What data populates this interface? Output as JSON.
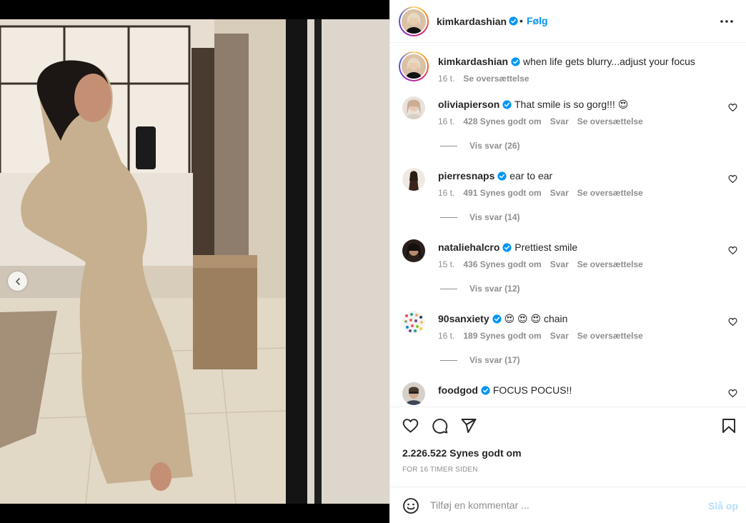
{
  "post": {
    "author": "kimkardashian",
    "follow_label": "Følg",
    "separator": "•",
    "caption": "when life gets blurry...adjust your focus",
    "caption_time": "16 t.",
    "caption_translate": "Se oversættelse",
    "likes": "2.226.522 Synes godt om",
    "posted_ago": "FOR 16 TIMER SIDEN",
    "carousel": {
      "total": 3,
      "active": 3
    }
  },
  "comments": [
    {
      "user": "oliviapierson",
      "text": "That smile is so gorg!!! 😍",
      "time": "16 t.",
      "likes": "428 Synes godt om",
      "reply": "Svar",
      "translate": "Se oversættelse",
      "view_replies": "Vis svar (26)"
    },
    {
      "user": "pierresnaps",
      "text": "ear to ear",
      "time": "16 t.",
      "likes": "491 Synes godt om",
      "reply": "Svar",
      "translate": "Se oversættelse",
      "view_replies": "Vis svar (14)"
    },
    {
      "user": "nataliehalcro",
      "text": "Prettiest smile",
      "time": "15 t.",
      "likes": "436 Synes godt om",
      "reply": "Svar",
      "translate": "Se oversættelse",
      "view_replies": "Vis svar (12)"
    },
    {
      "user": "90sanxiety",
      "text": "😍 😍 😍 chain",
      "time": "16 t.",
      "likes": "189 Synes godt om",
      "reply": "Svar",
      "translate": "Se oversættelse",
      "view_replies": "Vis svar (17)"
    },
    {
      "user": "foodgod",
      "text": "FOCUS POCUS!!"
    }
  ],
  "composer": {
    "placeholder": "Tilføj en kommentar ...",
    "post_label": "Slå op"
  },
  "icons": {
    "like": "heart-icon",
    "comment": "comment-bubble-icon",
    "share": "paper-plane-icon",
    "save": "bookmark-icon",
    "more": "more-horizontal-icon",
    "emoji": "emoji-icon",
    "verified": "verified-badge-icon",
    "prev": "chevron-left-icon"
  },
  "colors": {
    "accent": "#0095f6",
    "verified": "#0095f6",
    "post_disabled": "#b2dffc",
    "secondary_text": "#8e8e8e"
  }
}
